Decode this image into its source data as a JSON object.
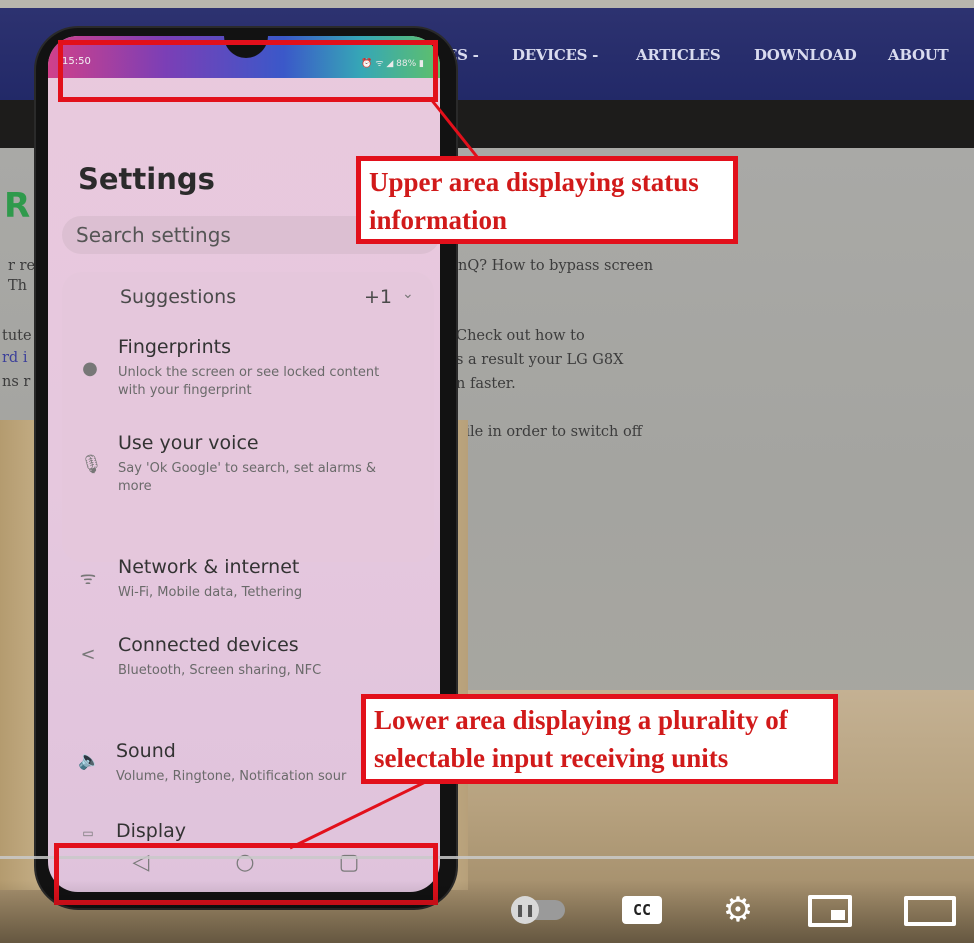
{
  "website": {
    "nav": [
      "ES -",
      "DEVICES -",
      "ARTICLES",
      "DOWNLOAD",
      "ABOUT"
    ],
    "logo_letter": "R",
    "body_lines": [
      "nQ? How to bypass screen",
      "Check out how to",
      "s a result your LG G8X",
      "n faster.",
      "hile in order to switch off"
    ],
    "left_fragments": [
      "r re",
      "Th",
      "tute",
      "rd i",
      "ns r"
    ]
  },
  "phone": {
    "status_time": "15:50",
    "status_icons": "⏰ ᯤ ◢ 88% ▮",
    "title": "Settings",
    "search_placeholder": "Search settings",
    "suggestions": {
      "label": "Suggestions",
      "badge": "+1"
    },
    "items": [
      {
        "title": "Fingerprints",
        "subtitle": "Unlock the screen or see locked content with your fingerprint",
        "icon": "fingerprint-icon"
      },
      {
        "title": "Use your voice",
        "subtitle": "Say 'Ok Google' to search, set alarms & more",
        "icon": "microphone-icon"
      },
      {
        "title": "Network & internet",
        "subtitle": "Wi-Fi, Mobile data, Tethering",
        "icon": "wifi-icon"
      },
      {
        "title": "Connected devices",
        "subtitle": "Bluetooth, Screen sharing, NFC",
        "icon": "share-icon"
      },
      {
        "title": "Sound",
        "subtitle": "Volume, Ringtone, Notification sour",
        "icon": "speaker-icon"
      },
      {
        "title": "Display",
        "subtitle": "",
        "icon": "display-icon"
      }
    ],
    "nav_buttons": [
      "back",
      "home",
      "recents"
    ]
  },
  "annotations": {
    "upper": "Upper area displaying status information",
    "lower": "Lower area displaying a plurality of selectable input receiving units",
    "color": "#e2101b"
  },
  "player": {
    "controls": [
      "autoplay-toggle",
      "cc",
      "settings",
      "miniplayer",
      "theater"
    ],
    "cc_label": "CC"
  }
}
